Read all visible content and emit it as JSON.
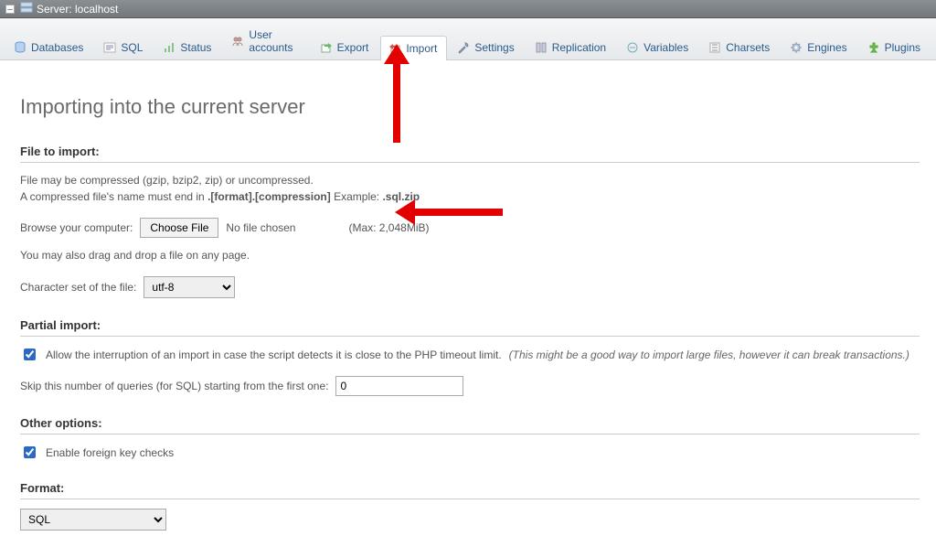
{
  "server_bar": {
    "label": "Server: localhost"
  },
  "tabs": {
    "databases": "Databases",
    "sql": "SQL",
    "status": "Status",
    "user_accounts": "User accounts",
    "export": "Export",
    "import": "Import",
    "settings": "Settings",
    "replication": "Replication",
    "variables": "Variables",
    "charsets": "Charsets",
    "engines": "Engines",
    "plugins": "Plugins"
  },
  "page_title": "Importing into the current server",
  "file_to_import": {
    "heading": "File to import:",
    "help_line1": "File may be compressed (gzip, bzip2, zip) or uncompressed.",
    "help_line2_prefix": "A compressed file's name must end in ",
    "help_line2_bold": ".[format].[compression]",
    "help_line2_mid": " Example: ",
    "help_line2_example": ".sql.zip",
    "browse_label": "Browse your computer:",
    "choose_file_button": "Choose File",
    "no_file_chosen": "No file chosen",
    "max_size": "(Max: 2,048MiB)",
    "drag_drop_note": "You may also drag and drop a file on any page.",
    "charset_label": "Character set of the file:",
    "charset_value": "utf-8"
  },
  "partial_import": {
    "heading": "Partial import:",
    "allow_interrupt_checked": true,
    "allow_interrupt_label": "Allow the interruption of an import in case the script detects it is close to the PHP timeout limit.",
    "allow_interrupt_note": "(This might be a good way to import large files, however it can break transactions.)",
    "skip_label": "Skip this number of queries (for SQL) starting from the first one:",
    "skip_value": "0"
  },
  "other_options": {
    "heading": "Other options:",
    "fk_checked": true,
    "fk_label": "Enable foreign key checks"
  },
  "format": {
    "heading": "Format:",
    "value": "SQL"
  }
}
